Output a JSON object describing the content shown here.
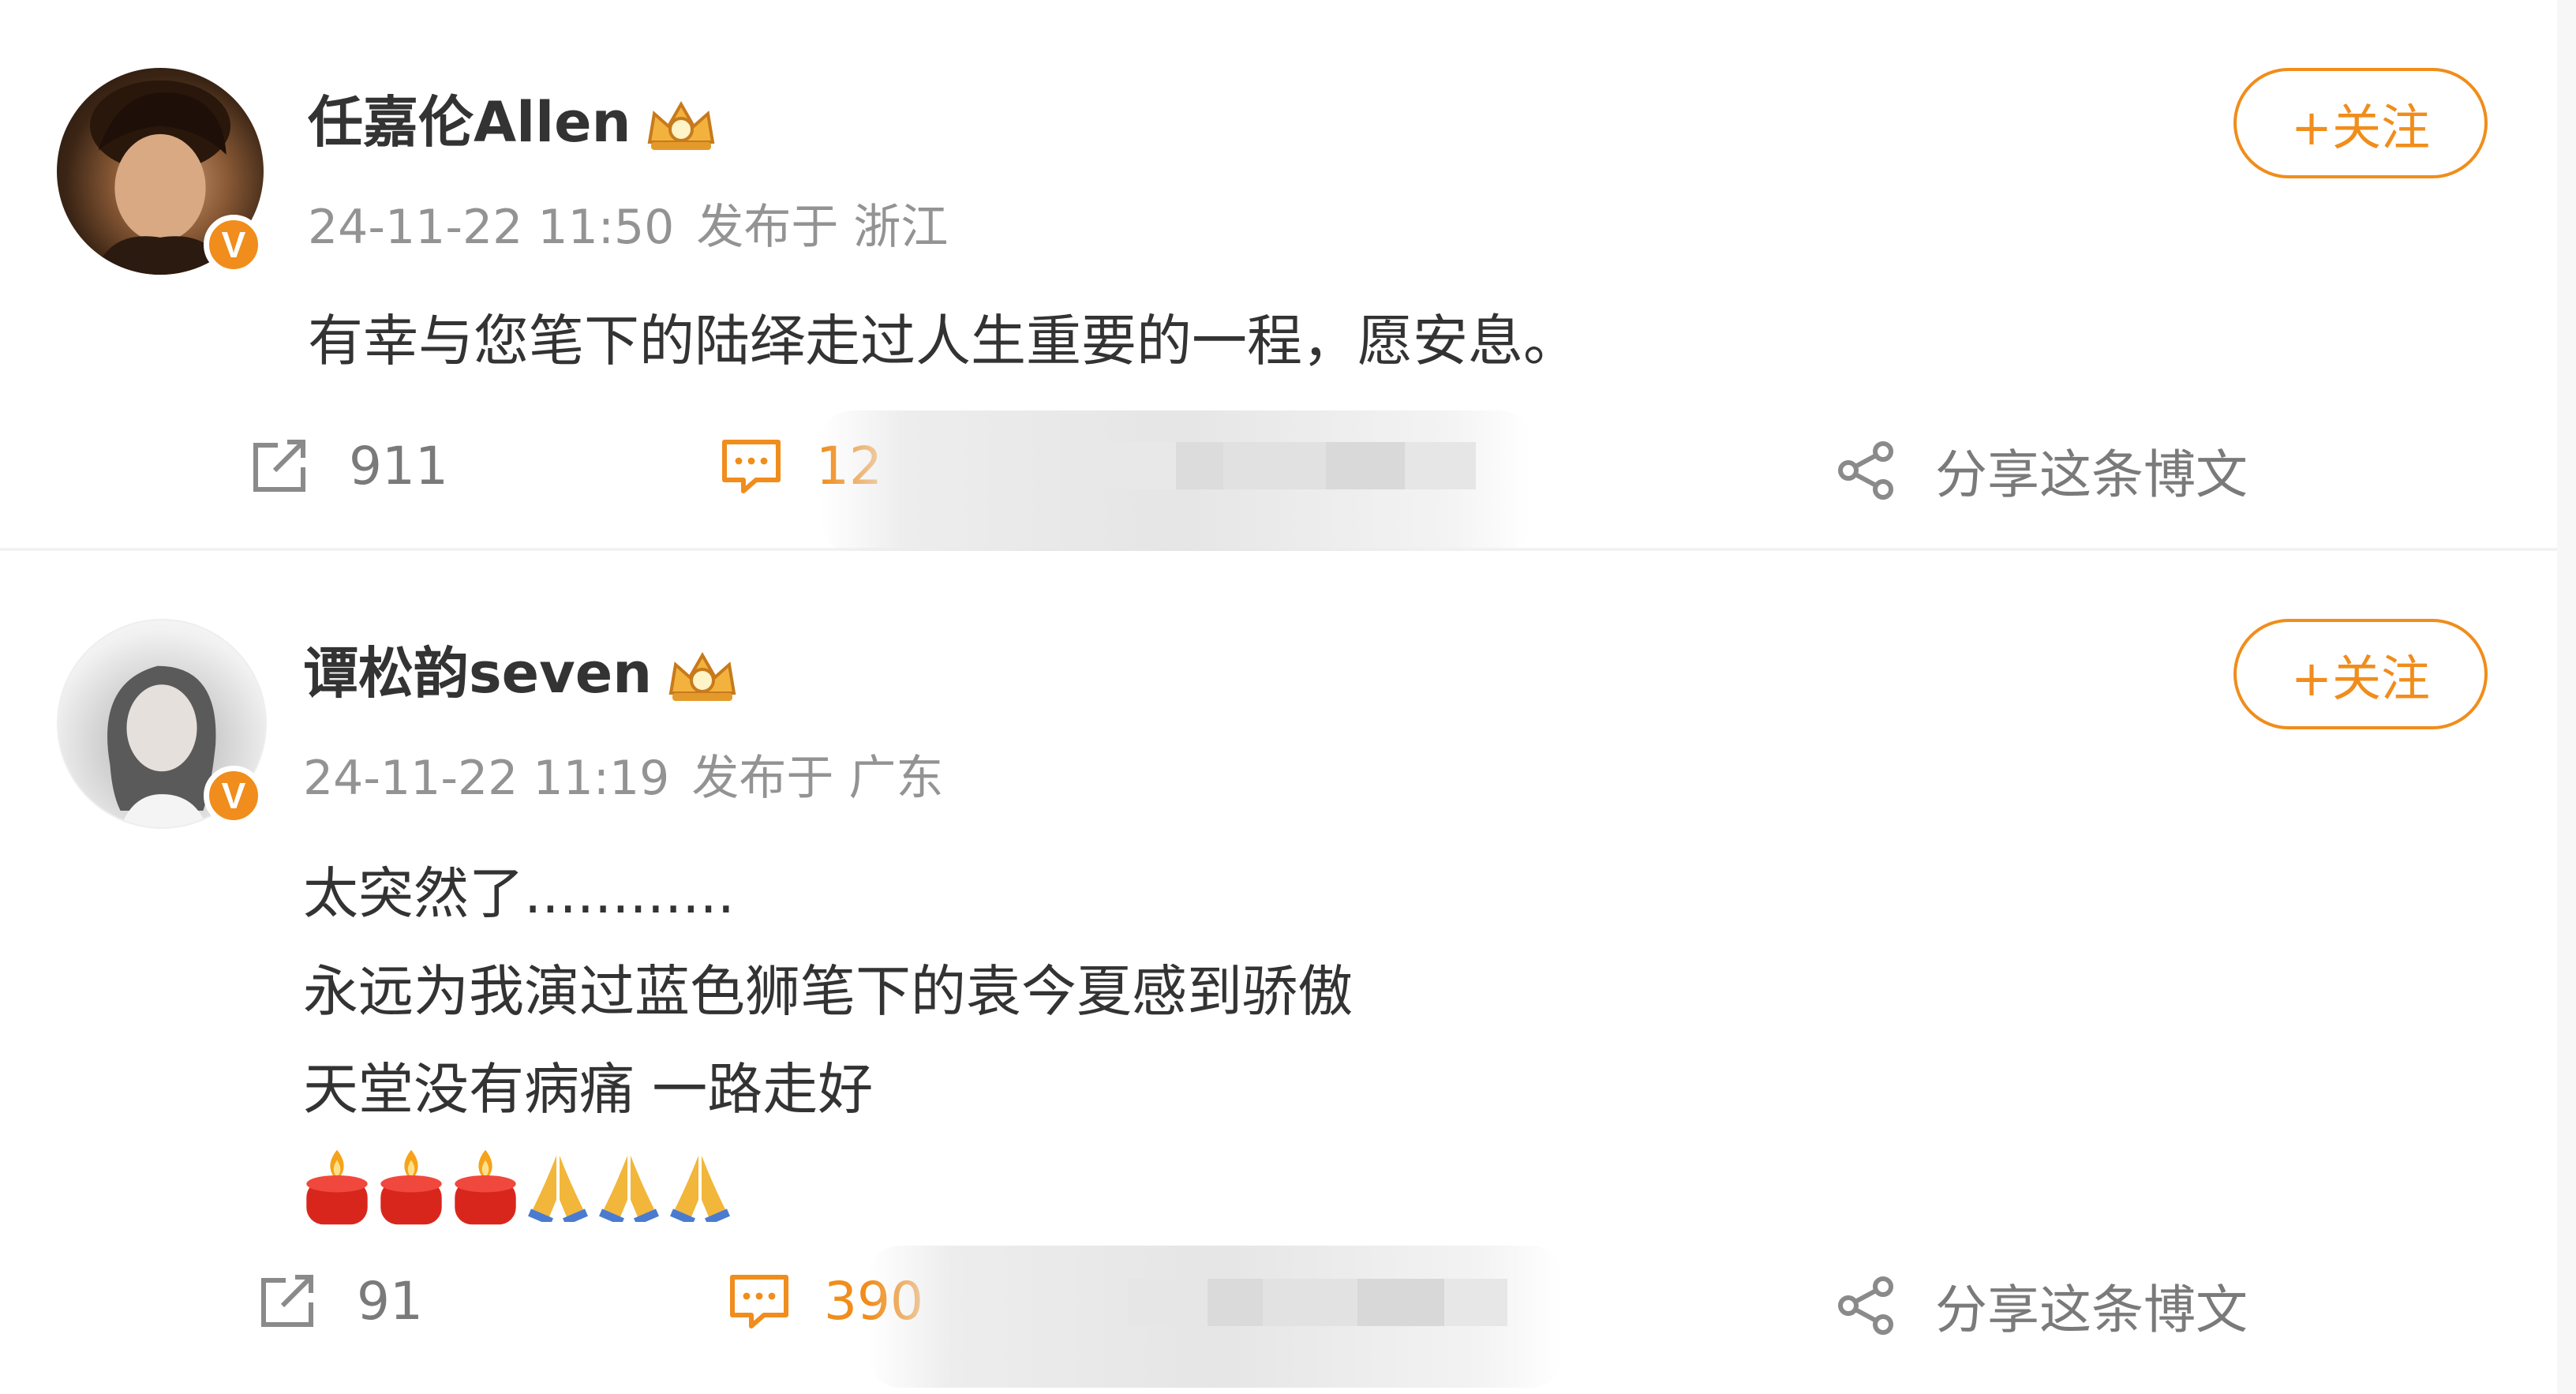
{
  "posts": [
    {
      "username": "任嘉伦Allen",
      "timestamp": "24-11-22 11:50",
      "source": "发布于 浙江",
      "follow_label": "+关注",
      "text_lines": [
        "有幸与您笔下的陆绎走过人生重要的一程，愿安息。"
      ],
      "reposts": "911",
      "comments": "12",
      "share_label": "分享这条博文"
    },
    {
      "username": "谭松韵seven",
      "timestamp": "24-11-22 11:19",
      "source": "发布于 广东",
      "follow_label": "+关注",
      "text_lines": [
        "太突然了............",
        "永远为我演过蓝色狮笔下的袁今夏感到骄傲",
        "天堂没有病痛 一路走好"
      ],
      "emoji": [
        "candle",
        "candle",
        "candle",
        "folded-hands",
        "folded-hands",
        "folded-hands"
      ],
      "reposts": "91",
      "comments": "390",
      "share_label": "分享这条博文"
    }
  ],
  "colors": {
    "accent": "#f08d1c",
    "meta": "#939393",
    "text": "#333333"
  }
}
